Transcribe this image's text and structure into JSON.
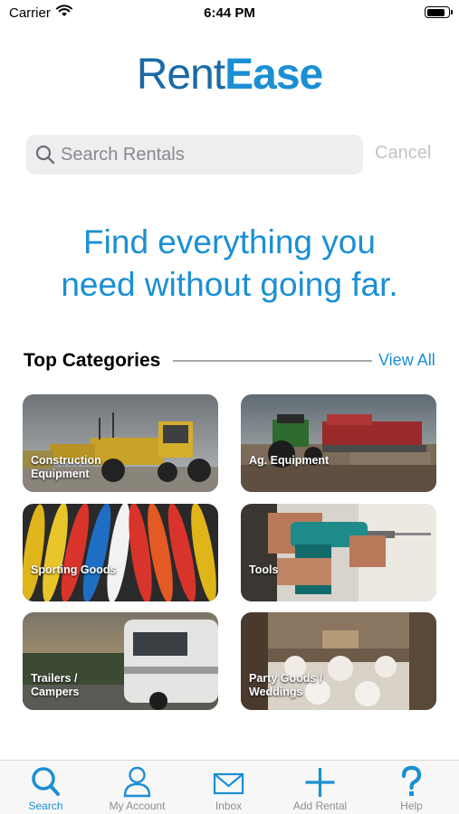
{
  "status_bar": {
    "carrier": "Carrier",
    "time": "6:44 PM",
    "battery_level": 0.85
  },
  "brand": {
    "name_part1": "Rent",
    "name_part2": "Ease",
    "color_dark": "#1b6aa5",
    "color_light": "#1b8fd3"
  },
  "search": {
    "placeholder": "Search Rentals",
    "value": "",
    "cancel_label": "Cancel"
  },
  "tagline": "Find everything you\nneed without going far.",
  "categories_section": {
    "title": "Top Categories",
    "view_all_label": "View All",
    "items": [
      {
        "label": "Construction\nEquipment",
        "icon": "construction-equipment-photo"
      },
      {
        "label": "Ag. Equipment",
        "icon": "tractor-photo"
      },
      {
        "label": "Sporting Goods",
        "icon": "kayaks-photo"
      },
      {
        "label": "Tools",
        "icon": "power-drill-photo"
      },
      {
        "label": "Trailers /\nCampers",
        "icon": "camper-photo"
      },
      {
        "label": "Party Goods /\nWeddings",
        "icon": "wedding-hall-photo"
      }
    ]
  },
  "tab_bar": {
    "active_color": "#1b8fd3",
    "inactive_color": "#8e8e93",
    "tabs": [
      {
        "label": "Search",
        "icon": "search-icon",
        "active": true
      },
      {
        "label": "My Account",
        "icon": "person-icon",
        "active": false
      },
      {
        "label": "Inbox",
        "icon": "envelope-icon",
        "active": false
      },
      {
        "label": "Add Rental",
        "icon": "plus-icon",
        "active": false
      },
      {
        "label": "Help",
        "icon": "question-mark-icon",
        "active": false
      }
    ]
  }
}
